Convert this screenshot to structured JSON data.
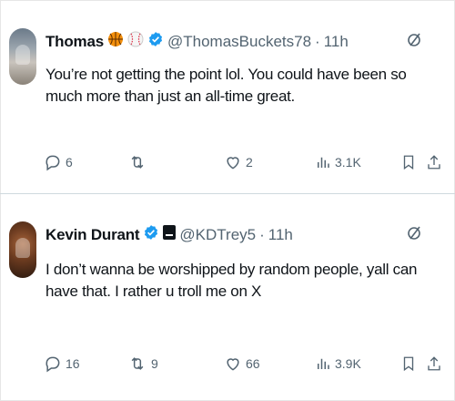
{
  "tweets": [
    {
      "name": "Thomas",
      "handle": "@ThomasBuckets78",
      "time": "11h",
      "text": "You’re not getting the point lol. You could have been so much more than just an all-time great.",
      "badges": [
        "basketball-emoji",
        "baseball-emoji",
        "verified-icon"
      ],
      "replies": "6",
      "retweets": "",
      "likes": "2",
      "views": "3.1K"
    },
    {
      "name": "Kevin Durant",
      "handle": "@KDTrey5",
      "time": "11h",
      "text": "I don’t wanna be worshipped by random people, yall can have that. I rather u troll me on X",
      "badges": [
        "verified-icon",
        "affiliate-badge-icon"
      ],
      "replies": "16",
      "retweets": "9",
      "likes": "66",
      "views": "3.9K"
    }
  ],
  "ui": {
    "separator": "·"
  },
  "colors": {
    "verified": "#1d9bf0",
    "muted": "#536471",
    "text": "#0f1419"
  }
}
